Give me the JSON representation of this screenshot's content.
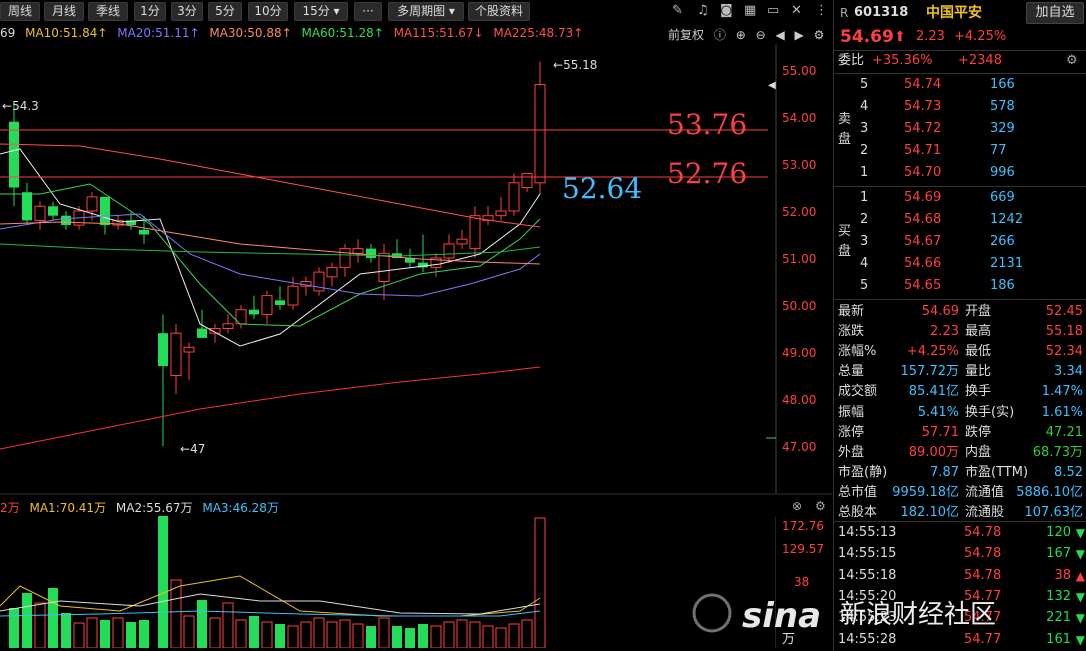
{
  "toolbar": {
    "buttons": [
      "周线",
      "月线",
      "季线",
      "1分",
      "3分",
      "5分",
      "10分",
      "15分 ▾",
      "···",
      "多周期图 ▾",
      "个股资料"
    ],
    "right_icons": [
      "edit-icon",
      "bell-icon",
      "camera-icon",
      "grid-icon",
      "window-icon",
      "close-icon"
    ]
  },
  "ma": {
    "prefix": "69",
    "ma10": "MA10:51.84↑",
    "ma20": "MA20:51.11↑",
    "ma30": "MA30:50.88↑",
    "ma60": "MA60:51.28↑",
    "ma115": "MA115:51.67↓",
    "ma225": "MA225:48.73↑"
  },
  "controls": {
    "fuquan": "前复权"
  },
  "chart": {
    "price_ticks": [
      "55.00",
      "54.00",
      "53.00",
      "52.00",
      "51.00",
      "50.00",
      "49.00",
      "48.00",
      "47.00"
    ],
    "annot_high": "55.18",
    "annot_low": "47",
    "annot_left": "54.3",
    "level1": "53.76",
    "level2": "52.76",
    "level3": "52.64"
  },
  "volume": {
    "prefix": "2万",
    "ma1": "MA1:70.41万",
    "ma2": "MA2:55.67万",
    "ma3": "MA3:46.28万",
    "ticks": [
      "172.76",
      "129.57",
      "38"
    ],
    "unit": "万"
  },
  "quote": {
    "market": "R",
    "code": "601318",
    "name": "中国平安",
    "add_btn": "加自选",
    "price": "54.69",
    "change": "2.23",
    "pct": "+4.25%",
    "weibi_label": "委比",
    "weibi_pct": "+35.36%",
    "weibi_diff": "+2348"
  },
  "sell": {
    "label": "卖盘",
    "rows": [
      {
        "lvl": "5",
        "price": "54.74",
        "vol": "166"
      },
      {
        "lvl": "4",
        "price": "54.73",
        "vol": "578"
      },
      {
        "lvl": "3",
        "price": "54.72",
        "vol": "329"
      },
      {
        "lvl": "2",
        "price": "54.71",
        "vol": "77"
      },
      {
        "lvl": "1",
        "price": "54.70",
        "vol": "996"
      }
    ]
  },
  "buy": {
    "label": "买盘",
    "rows": [
      {
        "lvl": "1",
        "price": "54.69",
        "vol": "669"
      },
      {
        "lvl": "2",
        "price": "54.68",
        "vol": "1242"
      },
      {
        "lvl": "3",
        "price": "54.67",
        "vol": "266"
      },
      {
        "lvl": "4",
        "price": "54.66",
        "vol": "2131"
      },
      {
        "lvl": "5",
        "price": "54.65",
        "vol": "186"
      }
    ]
  },
  "stats": [
    {
      "l1": "最新",
      "v1": "54.69",
      "c1": "red",
      "l2": "开盘",
      "v2": "52.45",
      "c2": "red"
    },
    {
      "l1": "涨跌",
      "v1": "2.23",
      "c1": "red",
      "l2": "最高",
      "v2": "55.18",
      "c2": "red"
    },
    {
      "l1": "涨幅%",
      "v1": "+4.25%",
      "c1": "red",
      "l2": "最低",
      "v2": "52.34",
      "c2": "red"
    },
    {
      "l1": "总量",
      "v1": "157.72万",
      "c1": "cyan",
      "l2": "量比",
      "v2": "3.34",
      "c2": "cyan"
    },
    {
      "l1": "成交额",
      "v1": "85.41亿",
      "c1": "cyan",
      "l2": "换手",
      "v2": "1.47%",
      "c2": "cyan"
    },
    {
      "l1": "振幅",
      "v1": "5.41%",
      "c1": "cyan",
      "l2": "换手(实)",
      "v2": "1.61%",
      "c2": "cyan"
    },
    {
      "l1": "涨停",
      "v1": "57.71",
      "c1": "red",
      "l2": "跌停",
      "v2": "47.21",
      "c2": "green"
    },
    {
      "l1": "外盘",
      "v1": "89.00万",
      "c1": "red",
      "l2": "内盘",
      "v2": "68.73万",
      "c2": "green"
    },
    {
      "l1": "市盈(静)",
      "v1": "7.87",
      "c1": "cyan",
      "l2": "市盈(TTM)",
      "v2": "8.52",
      "c2": "cyan"
    },
    {
      "l1": "总市值",
      "v1": "9959.18亿",
      "c1": "cyan",
      "l2": "流通值",
      "v2": "5886.10亿",
      "c2": "cyan"
    },
    {
      "l1": "总股本",
      "v1": "182.10亿",
      "c1": "cyan",
      "l2": "流通股",
      "v2": "107.63亿",
      "c2": "cyan"
    }
  ],
  "ticks": [
    {
      "time": "14:55:13",
      "price": "54.78",
      "vol": "120",
      "dir": "down"
    },
    {
      "time": "14:55:15",
      "price": "54.78",
      "vol": "167",
      "dir": "down"
    },
    {
      "time": "14:55:18",
      "price": "54.78",
      "vol": "38",
      "dir": "up"
    },
    {
      "time": "14:55:20",
      "price": "54.77",
      "vol": "132",
      "dir": "down"
    },
    {
      "time": "14:55:23",
      "price": "54.77",
      "vol": "221",
      "dir": "down"
    },
    {
      "time": "14:55:28",
      "price": "54.77",
      "vol": "161",
      "dir": "down"
    }
  ],
  "watermark": {
    "brand": "sina",
    "text": "新浪财经社区"
  },
  "colors": {
    "up": "#ff4040",
    "down": "#22dd55",
    "cyan": "#3ec0ff",
    "bg": "#000000"
  }
}
